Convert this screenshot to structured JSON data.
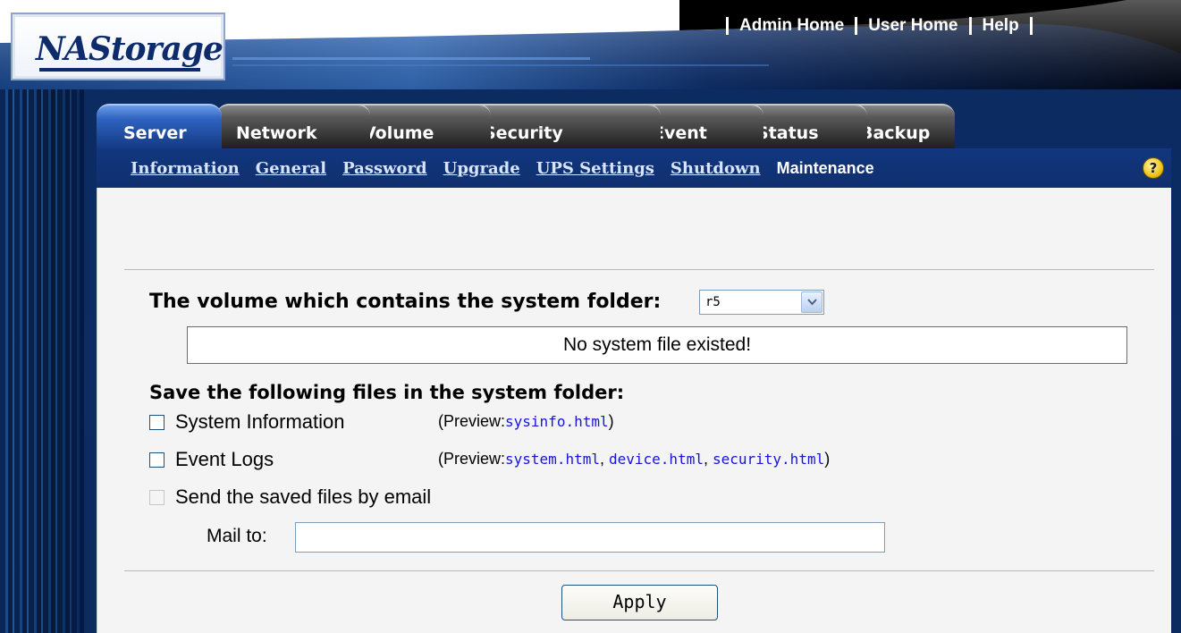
{
  "header": {
    "logo_text": "NAStorage",
    "links": [
      {
        "label": "Admin Home"
      },
      {
        "label": "User Home"
      },
      {
        "label": "Help"
      }
    ]
  },
  "tabs": [
    {
      "label": "Server",
      "active": true
    },
    {
      "label": "Network",
      "active": false
    },
    {
      "label": "Volume",
      "active": false
    },
    {
      "label": "Security",
      "active": false
    },
    {
      "label": "Event",
      "active": false
    },
    {
      "label": "Status",
      "active": false
    },
    {
      "label": "Backup",
      "active": false
    }
  ],
  "subnav": {
    "items": [
      {
        "label": "Information"
      },
      {
        "label": "General"
      },
      {
        "label": "Password"
      },
      {
        "label": "Upgrade"
      },
      {
        "label": "UPS Settings"
      },
      {
        "label": "Shutdown"
      },
      {
        "label": "Maintenance",
        "current": true
      }
    ],
    "help_icon": "?"
  },
  "maintenance": {
    "volume_label": "The volume which contains the system folder:",
    "volume_value": "r5",
    "status_message": "No system file existed!",
    "save_label": "Save the following files in the system folder:",
    "options": [
      {
        "label": "System Information",
        "checked": false,
        "preview_prefix": "(Preview:",
        "preview_links": [
          "sysinfo.html"
        ],
        "preview_suffix": ")"
      },
      {
        "label": "Event Logs",
        "checked": false,
        "preview_prefix": "(Preview:",
        "preview_links": [
          "system.html",
          "device.html",
          "security.html"
        ],
        "preview_suffix": ")"
      },
      {
        "label": "Send the saved files by email",
        "checked": false,
        "disabled": true
      }
    ],
    "mail_to_label": "Mail to:",
    "mail_to_value": "",
    "apply_label": "Apply"
  },
  "colors": {
    "nav_blue": "#12377f",
    "link_blue": "#1515d6",
    "panel_bg": "#f4f4f4"
  }
}
